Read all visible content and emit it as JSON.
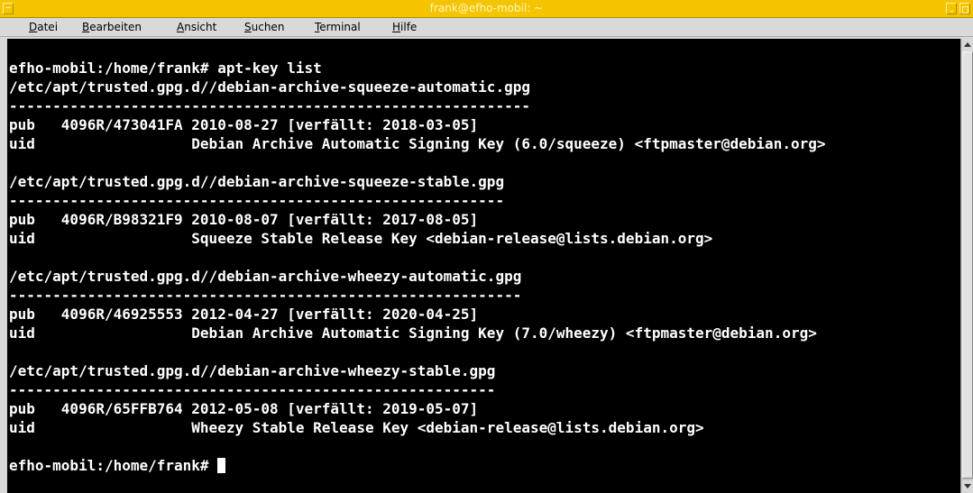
{
  "window": {
    "title": "frank@efho-mobil: ~"
  },
  "menu": [
    {
      "mnemonic": "D",
      "rest": "atei"
    },
    {
      "mnemonic": "B",
      "rest": "earbeiten"
    },
    {
      "mnemonic": "A",
      "rest": "nsicht"
    },
    {
      "mnemonic": "S",
      "rest": "uchen"
    },
    {
      "mnemonic": "T",
      "rest": "erminal"
    },
    {
      "mnemonic": "H",
      "rest": "ilfe"
    }
  ],
  "terminal": {
    "lines": [
      "efho-mobil:/home/frank# apt-key list",
      "/etc/apt/trusted.gpg.d//debian-archive-squeeze-automatic.gpg",
      "------------------------------------------------------------",
      "pub   4096R/473041FA 2010-08-27 [verfällt: 2018-03-05]",
      "uid                  Debian Archive Automatic Signing Key (6.0/squeeze) <ftpmaster@debian.org>",
      "",
      "/etc/apt/trusted.gpg.d//debian-archive-squeeze-stable.gpg",
      "---------------------------------------------------------",
      "pub   4096R/B98321F9 2010-08-07 [verfällt: 2017-08-05]",
      "uid                  Squeeze Stable Release Key <debian-release@lists.debian.org>",
      "",
      "/etc/apt/trusted.gpg.d//debian-archive-wheezy-automatic.gpg",
      "-----------------------------------------------------------",
      "pub   4096R/46925553 2012-04-27 [verfällt: 2020-04-25]",
      "uid                  Debian Archive Automatic Signing Key (7.0/wheezy) <ftpmaster@debian.org>",
      "",
      "/etc/apt/trusted.gpg.d//debian-archive-wheezy-stable.gpg",
      "--------------------------------------------------------",
      "pub   4096R/65FFB764 2012-05-08 [verfällt: 2019-05-07]",
      "uid                  Wheezy Stable Release Key <debian-release@lists.debian.org>",
      "",
      "efho-mobil:/home/frank# "
    ]
  }
}
